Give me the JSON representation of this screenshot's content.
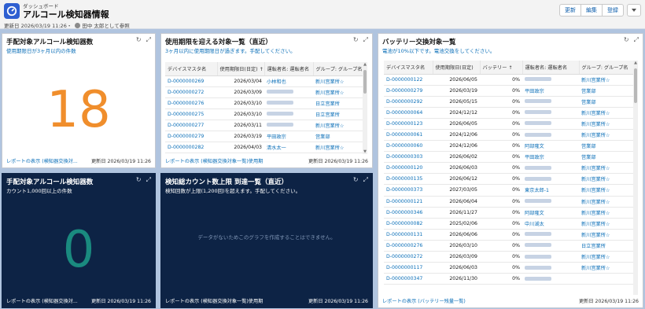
{
  "header": {
    "breadcrumb": "ダッシュボード",
    "title": "アルコール検知器情報",
    "updated": "更新日 2026/03/19 11:26",
    "separator": "・",
    "viewing_as": "田中 太郎として参照",
    "buttons": [
      "更新",
      "編集",
      "登録"
    ]
  },
  "cards": {
    "c1": {
      "title": "手配対象アルコール検知器数",
      "subtitle": "使用期限日が3ヶ月以内の件数",
      "value": "18",
      "report_link": "レポートの表示 (検知器交換対...",
      "updated": "更新日 2026/03/19 11:26"
    },
    "c2": {
      "title": "使用期限を迎える対象一覧（直近）",
      "subtitle": "3ヶ月以内に使用期限日が過ぎます。手配してください。",
      "columns": [
        "デバイスマスタ名",
        "使用期限日(日定)",
        "運転者名: 運転者名",
        "グループ: グループ名"
      ],
      "sort_arrow": "↑",
      "rows": [
        {
          "id": "D-0000000269",
          "date": "2026/03/04",
          "driver": "小林和也",
          "group": "新川営業所☆"
        },
        {
          "id": "D-0000000272",
          "date": "2026/03/09",
          "driver": "",
          "group": "新川営業所☆"
        },
        {
          "id": "D-0000000276",
          "date": "2026/03/10",
          "driver": "",
          "group": "日立営業所"
        },
        {
          "id": "D-0000000275",
          "date": "2026/03/10",
          "driver": "",
          "group": "日立営業所"
        },
        {
          "id": "D-0000000277",
          "date": "2026/03/11",
          "driver": "",
          "group": "新川営業所☆"
        },
        {
          "id": "D-0000000279",
          "date": "2026/03/19",
          "driver": "平田政宗",
          "group": "営業部"
        },
        {
          "id": "D-0000000282",
          "date": "2026/04/03",
          "driver": "清水太一",
          "group": "新川営業所☆"
        }
      ],
      "report_link": "レポートの表示 (検知器交換対象一覧)使用期",
      "updated": "更新日 2026/03/19 11:26"
    },
    "c3": {
      "title": "バッテリー交換対象一覧",
      "subtitle": "電池が10%以下です。電池交換をしてください。",
      "columns": [
        "デバイスマスタ名",
        "使用期限日(日定)",
        "バッテリー ↑",
        "運転者名: 運転者名",
        "グループ: グループ名"
      ],
      "rows": [
        {
          "id": "D-0000000122",
          "date": "2026/06/05",
          "battery": "0%",
          "driver": "",
          "group": "新川営業所☆"
        },
        {
          "id": "D-0000000279",
          "date": "2026/03/19",
          "battery": "0%",
          "driver": "平田政宗",
          "group": "営業部"
        },
        {
          "id": "D-0000000292",
          "date": "2026/05/15",
          "battery": "0%",
          "driver": "",
          "group": "営業部"
        },
        {
          "id": "D-0000000064",
          "date": "2024/12/12",
          "battery": "0%",
          "driver": "",
          "group": "新川営業所☆"
        },
        {
          "id": "D-0000000123",
          "date": "2026/06/05",
          "battery": "0%",
          "driver": "",
          "group": "新川営業所☆"
        },
        {
          "id": "D-0000000061",
          "date": "2024/12/06",
          "battery": "0%",
          "driver": "",
          "group": "新川営業所☆"
        },
        {
          "id": "D-0000000060",
          "date": "2024/12/06",
          "battery": "0%",
          "driver": "阿部隆文",
          "group": "営業部"
        },
        {
          "id": "D-0000000303",
          "date": "2026/06/02",
          "battery": "0%",
          "driver": "平田政宗",
          "group": "営業部"
        },
        {
          "id": "D-0000000120",
          "date": "2026/06/03",
          "battery": "0%",
          "driver": "",
          "group": "新川営業所☆"
        },
        {
          "id": "D-0000000135",
          "date": "2026/06/12",
          "battery": "0%",
          "driver": "",
          "group": "新川営業所☆"
        },
        {
          "id": "D-0000000373",
          "date": "2027/03/05",
          "battery": "0%",
          "driver": "東京太郎-1",
          "group": "新川営業所☆"
        },
        {
          "id": "D-0000000121",
          "date": "2026/06/04",
          "battery": "0%",
          "driver": "",
          "group": "新川営業所☆"
        },
        {
          "id": "D-0000000346",
          "date": "2026/11/27",
          "battery": "0%",
          "driver": "阿部隆文",
          "group": "新川営業所☆"
        },
        {
          "id": "D-0000000082",
          "date": "2025/02/06",
          "battery": "0%",
          "driver": "中川湖太",
          "group": "新川営業所☆"
        },
        {
          "id": "D-0000000131",
          "date": "2026/06/06",
          "battery": "0%",
          "driver": "",
          "group": "新川営業所☆"
        },
        {
          "id": "D-0000000276",
          "date": "2026/03/10",
          "battery": "0%",
          "driver": "",
          "group": "日立営業所"
        },
        {
          "id": "D-0000000272",
          "date": "2026/03/09",
          "battery": "0%",
          "driver": "",
          "group": "新川営業所☆"
        },
        {
          "id": "D-0000000117",
          "date": "2026/06/03",
          "battery": "0%",
          "driver": "",
          "group": "新川営業所☆"
        },
        {
          "id": "D-0000000347",
          "date": "2026/11/30",
          "battery": "0%",
          "driver": "",
          "group": ""
        }
      ],
      "report_link": "レポートの表示 (バッテリー残量一覧)",
      "updated": "更新日 2026/03/19 11:26"
    },
    "c4": {
      "title": "手配対象アルコール検知器数",
      "subtitle": "カウント1,000回以上の件数",
      "value": "0",
      "report_link": "レポートの表示 (検知器交換対...",
      "updated": "更新日 2026/03/19 11:26"
    },
    "c5": {
      "title": "検知総カウント数上限 到達一覧（直近）",
      "subtitle": "検知回数が上限(1,200回)を超えます。手配してください。",
      "empty_message": "データがないためこのグラフを作成することはできません。",
      "report_link": "レポートの表示 (検知器交換対象一覧)使用期",
      "updated": "更新日 2026/03/19 11:26"
    }
  },
  "colors": {
    "accent": "#0b6fb8",
    "big_number_orange": "#f08e2c",
    "big_number_teal": "#1a8a7f",
    "dark_card": "#0d2345"
  },
  "icons": [
    "dashboard-icon",
    "user-icon",
    "refresh-icon",
    "expand-icon",
    "chevron-down-icon",
    "sort-up-icon"
  ]
}
